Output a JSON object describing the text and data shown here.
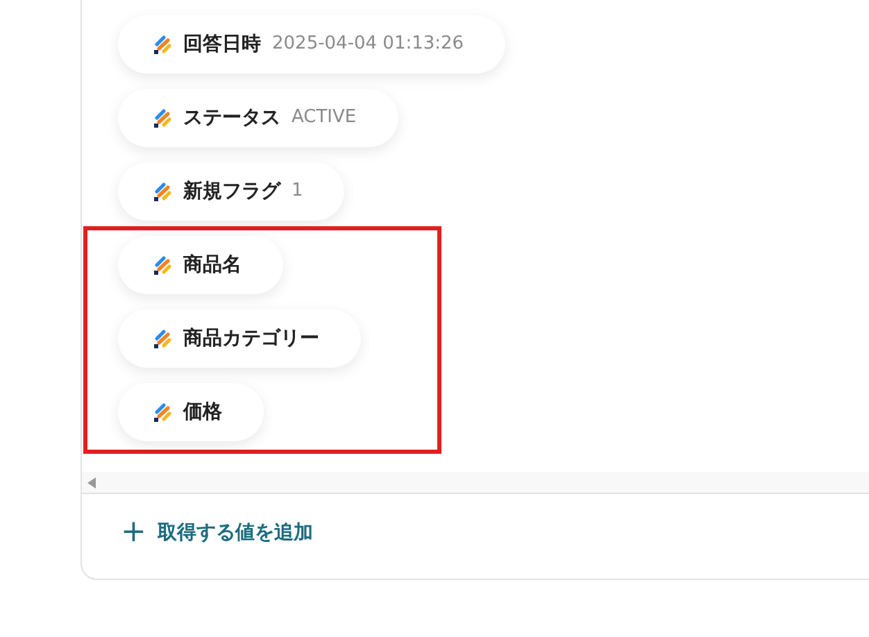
{
  "fields": [
    {
      "label": "回答日時",
      "value": "2025-04-04 01:13:26"
    },
    {
      "label": "ステータス",
      "value": "ACTIVE"
    },
    {
      "label": "新規フラグ",
      "value": "1"
    }
  ],
  "highlighted_fields": [
    {
      "label": "商品名"
    },
    {
      "label": "商品カテゴリー"
    },
    {
      "label": "価格"
    }
  ],
  "add_button": {
    "icon": "+",
    "label": "取得する値を追加"
  }
}
